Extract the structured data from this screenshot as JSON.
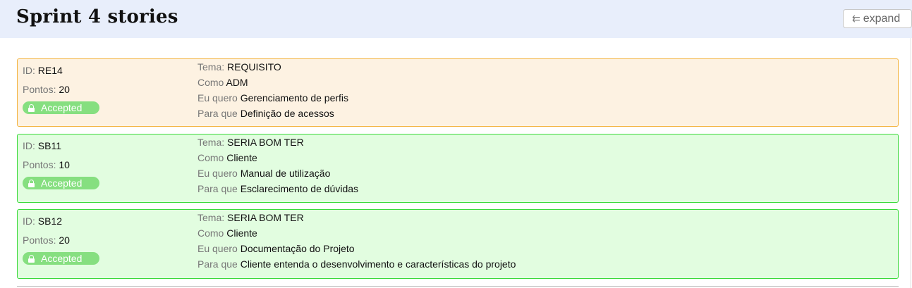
{
  "header": {
    "title": "Sprint 4 stories",
    "expand_label": "expand"
  },
  "labels": {
    "id": "ID:",
    "points": "Pontos:",
    "tema": "Tema:",
    "como": "Como",
    "eu_quero": "Eu quero",
    "para_que": "Para que"
  },
  "stories": [
    {
      "id": "RE14",
      "points": "20",
      "status": "Accepted",
      "tema": "REQUISITO",
      "como": "ADM",
      "eu_quero": "Gerenciamento de perfis",
      "para_que": "Definição de acessos",
      "color": "#f3b33e"
    },
    {
      "id": "SB11",
      "points": "10",
      "status": "Accepted",
      "tema": "SERIA BOM TER",
      "como": "Cliente",
      "eu_quero": "Manual de utilização",
      "para_que": "Esclarecimento de dúvidas",
      "color": "#3ad93a"
    },
    {
      "id": "SB12",
      "points": "20",
      "status": "Accepted",
      "tema": "SERIA BOM TER",
      "como": "Cliente",
      "eu_quero": "Documentação do Projeto",
      "para_que": "Cliente entenda o desenvolvimento e características do projeto",
      "color": "#3ad93a"
    }
  ]
}
